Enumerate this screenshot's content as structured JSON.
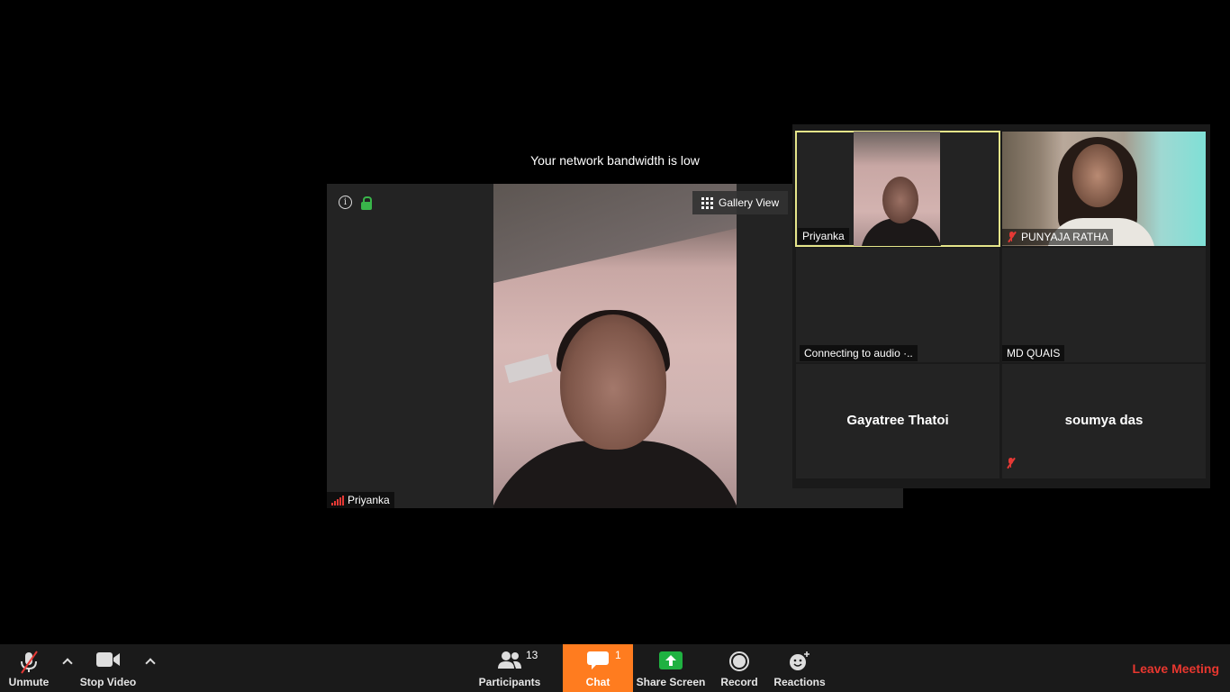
{
  "network_notice": "Your network bandwidth is low",
  "main_view": {
    "speaker_name": "Priyanka",
    "gallery_view_label": "Gallery View"
  },
  "gallery": {
    "tiles": [
      {
        "name": "Priyanka",
        "active": true
      },
      {
        "name": "PUNYAJA RATHA",
        "muted": true
      },
      {
        "name": "Connecting to audio ·.."
      },
      {
        "name": "MD QUAIS"
      },
      {
        "name": "Gayatree Thatoi"
      },
      {
        "name": "soumya das",
        "muted": true
      }
    ]
  },
  "toolbar": {
    "unmute_label": "Unmute",
    "stop_video_label": "Stop Video",
    "participants_label": "Participants",
    "participants_count": "13",
    "chat_label": "Chat",
    "chat_badge": "1",
    "share_screen_label": "Share Screen",
    "record_label": "Record",
    "reactions_label": "Reactions",
    "leave_label": "Leave Meeting"
  },
  "colors": {
    "chat_active": "#ff7c1f",
    "leave": "#e8372f",
    "share_green": "#1fb141",
    "active_speaker_border": "#e5e58a"
  }
}
